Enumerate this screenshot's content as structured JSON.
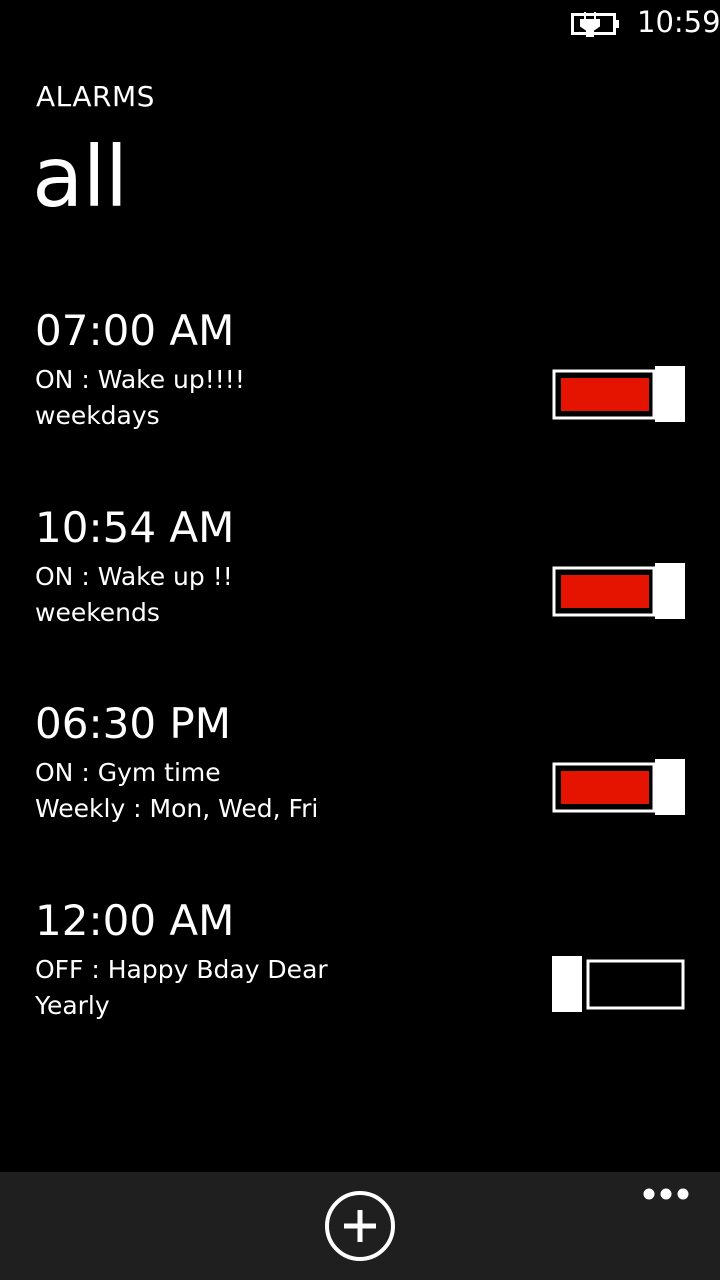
{
  "status_bar": {
    "time": "10:59",
    "icons": [
      "battery-charging-icon"
    ]
  },
  "header": {
    "app_title": "ALARMS",
    "pivot_title": "all"
  },
  "alarms": [
    {
      "time": "07:00 AM",
      "label": "ON : Wake up!!!!",
      "repeat": "weekdays",
      "enabled": true
    },
    {
      "time": "10:54 AM",
      "label": "ON : Wake up !!",
      "repeat": "weekends",
      "enabled": true
    },
    {
      "time": "06:30 PM",
      "label": "ON : Gym time",
      "repeat": "Weekly : Mon, Wed, Fri",
      "enabled": true
    },
    {
      "time": "12:00 AM",
      "label": "OFF : Happy Bday Dear",
      "repeat": "Yearly",
      "enabled": false
    }
  ],
  "app_bar": {
    "icons": [
      "add-icon",
      "more-icon"
    ]
  },
  "colors": {
    "accent": "#e51400",
    "background": "#000000",
    "app_bar": "#1f1f1f",
    "foreground": "#ffffff"
  }
}
